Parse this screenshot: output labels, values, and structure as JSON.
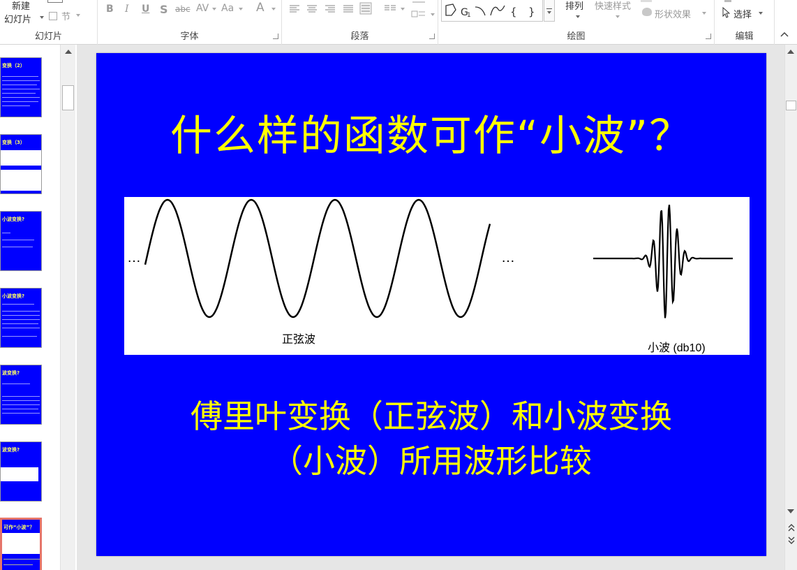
{
  "ribbon": {
    "slides_group": {
      "new_slide_line1": "新建",
      "new_slide_line2": "幻灯片",
      "section": "节",
      "label": "幻灯片"
    },
    "font_group": {
      "label": "字体",
      "bold": "B",
      "italic": "I",
      "underline": "U",
      "shadow": "S",
      "strike": "abc",
      "spacing": "AV",
      "case": "Aa",
      "font_color": "A"
    },
    "paragraph_group": {
      "label": "段落"
    },
    "drawing_group": {
      "label": "绘图",
      "arrange": "排列",
      "quick_styles": "快速样式",
      "shape_effects": "形状效果"
    },
    "editing_group": {
      "label": "编辑",
      "select": "选择"
    }
  },
  "thumbnails": [
    {
      "title": "变换（2）"
    },
    {
      "title": "变换（3）"
    },
    {
      "title": "小波变换?"
    },
    {
      "title": "小波变换?"
    },
    {
      "title": "波变换?"
    },
    {
      "title": "波变换?"
    },
    {
      "title": "可作“小波”？",
      "active": true
    }
  ],
  "slide": {
    "title": "什么样的函数可作“小波”？",
    "sine_label": "正弦波",
    "wavelet_label": "小波 (db10)",
    "ellipsis": "…",
    "caption_line1": "傅里叶变换（正弦波）和小波变换",
    "caption_line2": "（小波）所用波形比较"
  },
  "colors": {
    "slide_bg": "#0000ff",
    "title_color": "#ffff00",
    "active_thumb_border": "#e5756a"
  }
}
